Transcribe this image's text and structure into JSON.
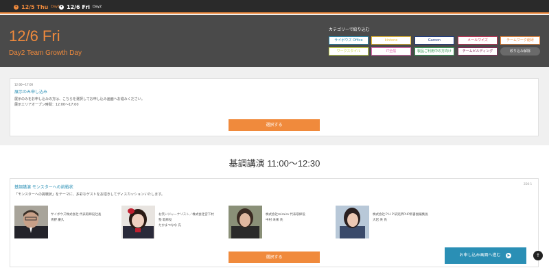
{
  "nav": {
    "tabs": [
      {
        "label": "12/5 Thu",
        "sub": "Day1"
      },
      {
        "label": "12/6 Fri",
        "sub": "Day2"
      }
    ]
  },
  "header": {
    "title": "12/6 Fri",
    "subtitle": "Day2 Team Growth Day",
    "category_label": "カテゴリーで絞り込む",
    "categories": [
      {
        "label": "サイボウズ Office",
        "color": "#2a8fb5"
      },
      {
        "label": "kintone",
        "color": "#f0c030"
      },
      {
        "label": "Garoon",
        "color": "#1a3a8a"
      },
      {
        "label": "メールワイズ",
        "color": "#d0345a"
      },
      {
        "label": "チームワーク総研",
        "color": "#f08a3c"
      },
      {
        "label": "ワークスタイル",
        "color": "#c8d84a"
      },
      {
        "label": "IT全般",
        "color": "#e06ab0"
      },
      {
        "label": "製品ご利用中の方向け",
        "color": "#3aa05a"
      },
      {
        "label": "チームビルディング",
        "color": "#8a2a5a"
      }
    ],
    "clear_label": "絞り込み解除"
  },
  "exhibit": {
    "time": "12:00～17:00",
    "title": "展示のみ申し込み",
    "desc": "展示のみをお申し込みの方は、こちらを選択してお申し込み画面へお進みください。",
    "hours": "展示エリアオープン時間：12:00～17:00",
    "button": "選択する"
  },
  "keynote": {
    "section_title": "基調講演 11:00〜12:30",
    "tag": "2D6-1",
    "title": "基調講演 モンスターへの挑戦状",
    "desc": "「モンスターへの挑戦状」をテーマに、多彩なゲストをお招きしてディスカッションいたします。",
    "speakers": [
      {
        "line1": "サイボウズ株式会社 代表取締役社長",
        "line2": "青野 慶久"
      },
      {
        "line1": "お笑いジャーナリスト／株式会社宮下村",
        "line2": "塾 取締役",
        "line3": "たかまつなな 氏"
      },
      {
        "line1": "株式会社mirairo 代表取締役",
        "line2": "中村 未来 氏"
      },
      {
        "line1": "株式会社ＰＨＰ研究所PHP新書副編集長",
        "line2": "大岩 央 氏"
      }
    ],
    "button": "選択する"
  },
  "apply_button": "お申し込み画面へ進む",
  "colors": {
    "accent": "#f08a3c",
    "link": "#2a8fb5",
    "header_bg": "#4a4a4a"
  }
}
